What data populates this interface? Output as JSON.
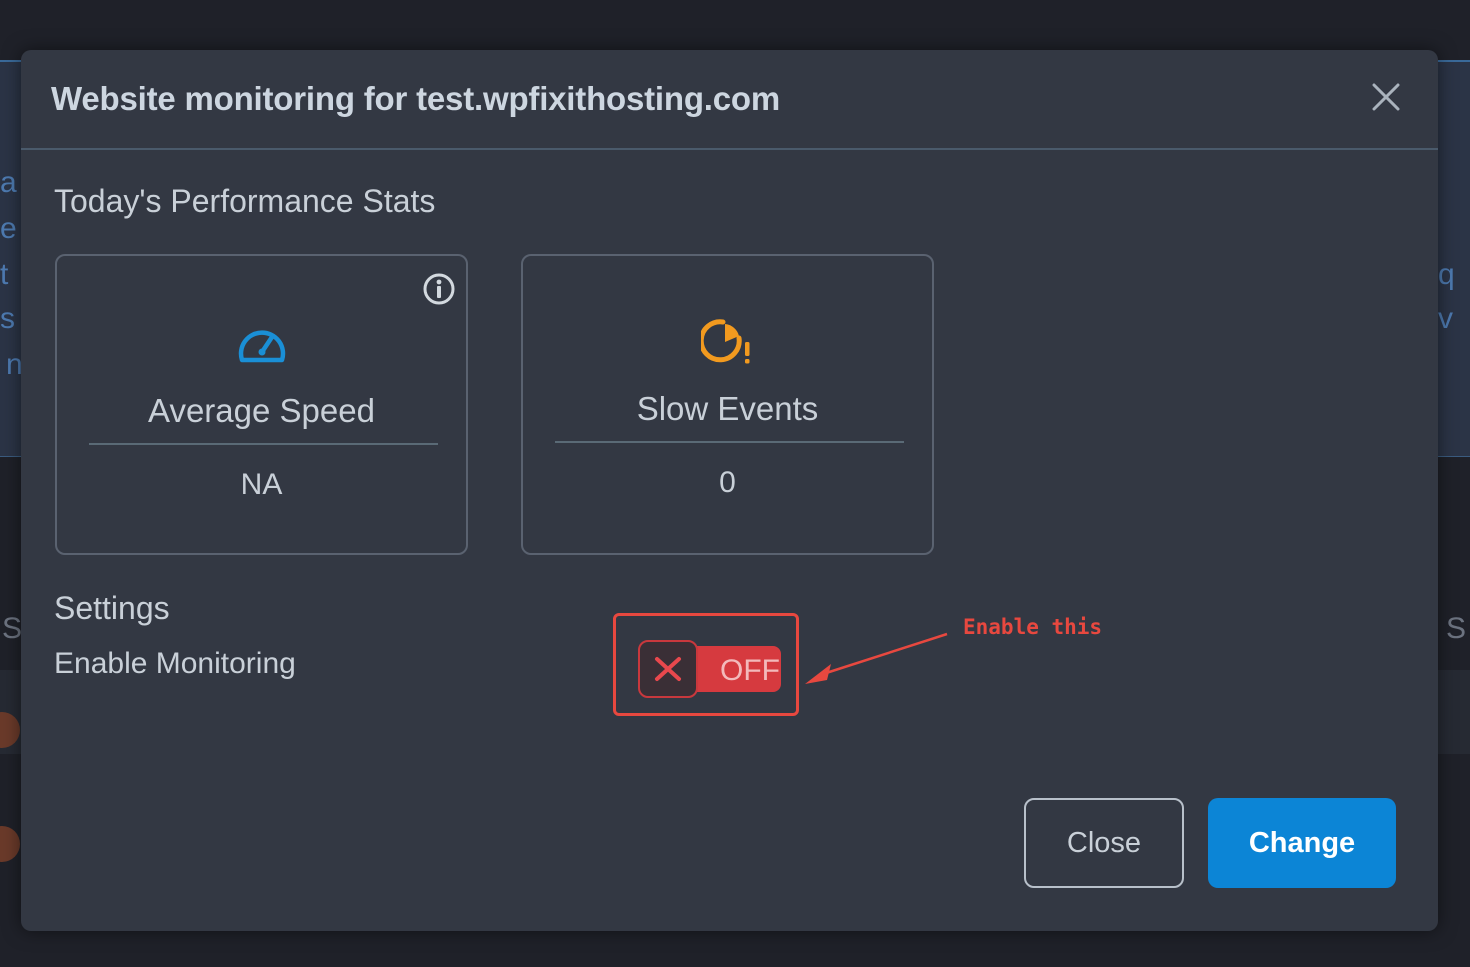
{
  "modal": {
    "title": "Website monitoring for test.wpfixithosting.com",
    "stats_heading": "Today's Performance Stats",
    "stats": [
      {
        "label": "Average Speed",
        "value": "NA",
        "icon": "speedometer-icon",
        "color": "#1a8fd6"
      },
      {
        "label": "Slow Events",
        "value": "0",
        "icon": "clock-warning-icon",
        "color": "#f29a1f"
      }
    ],
    "settings_heading": "Settings",
    "enable_monitoring_label": "Enable Monitoring",
    "toggle": {
      "state_text": "OFF",
      "enabled": false
    },
    "annotation": "Enable this",
    "buttons": {
      "close": "Close",
      "change": "Change"
    }
  },
  "colors": {
    "accent": "#0c85d6",
    "toggle_off": "#d63a3f",
    "annotation": "#e8483f"
  }
}
